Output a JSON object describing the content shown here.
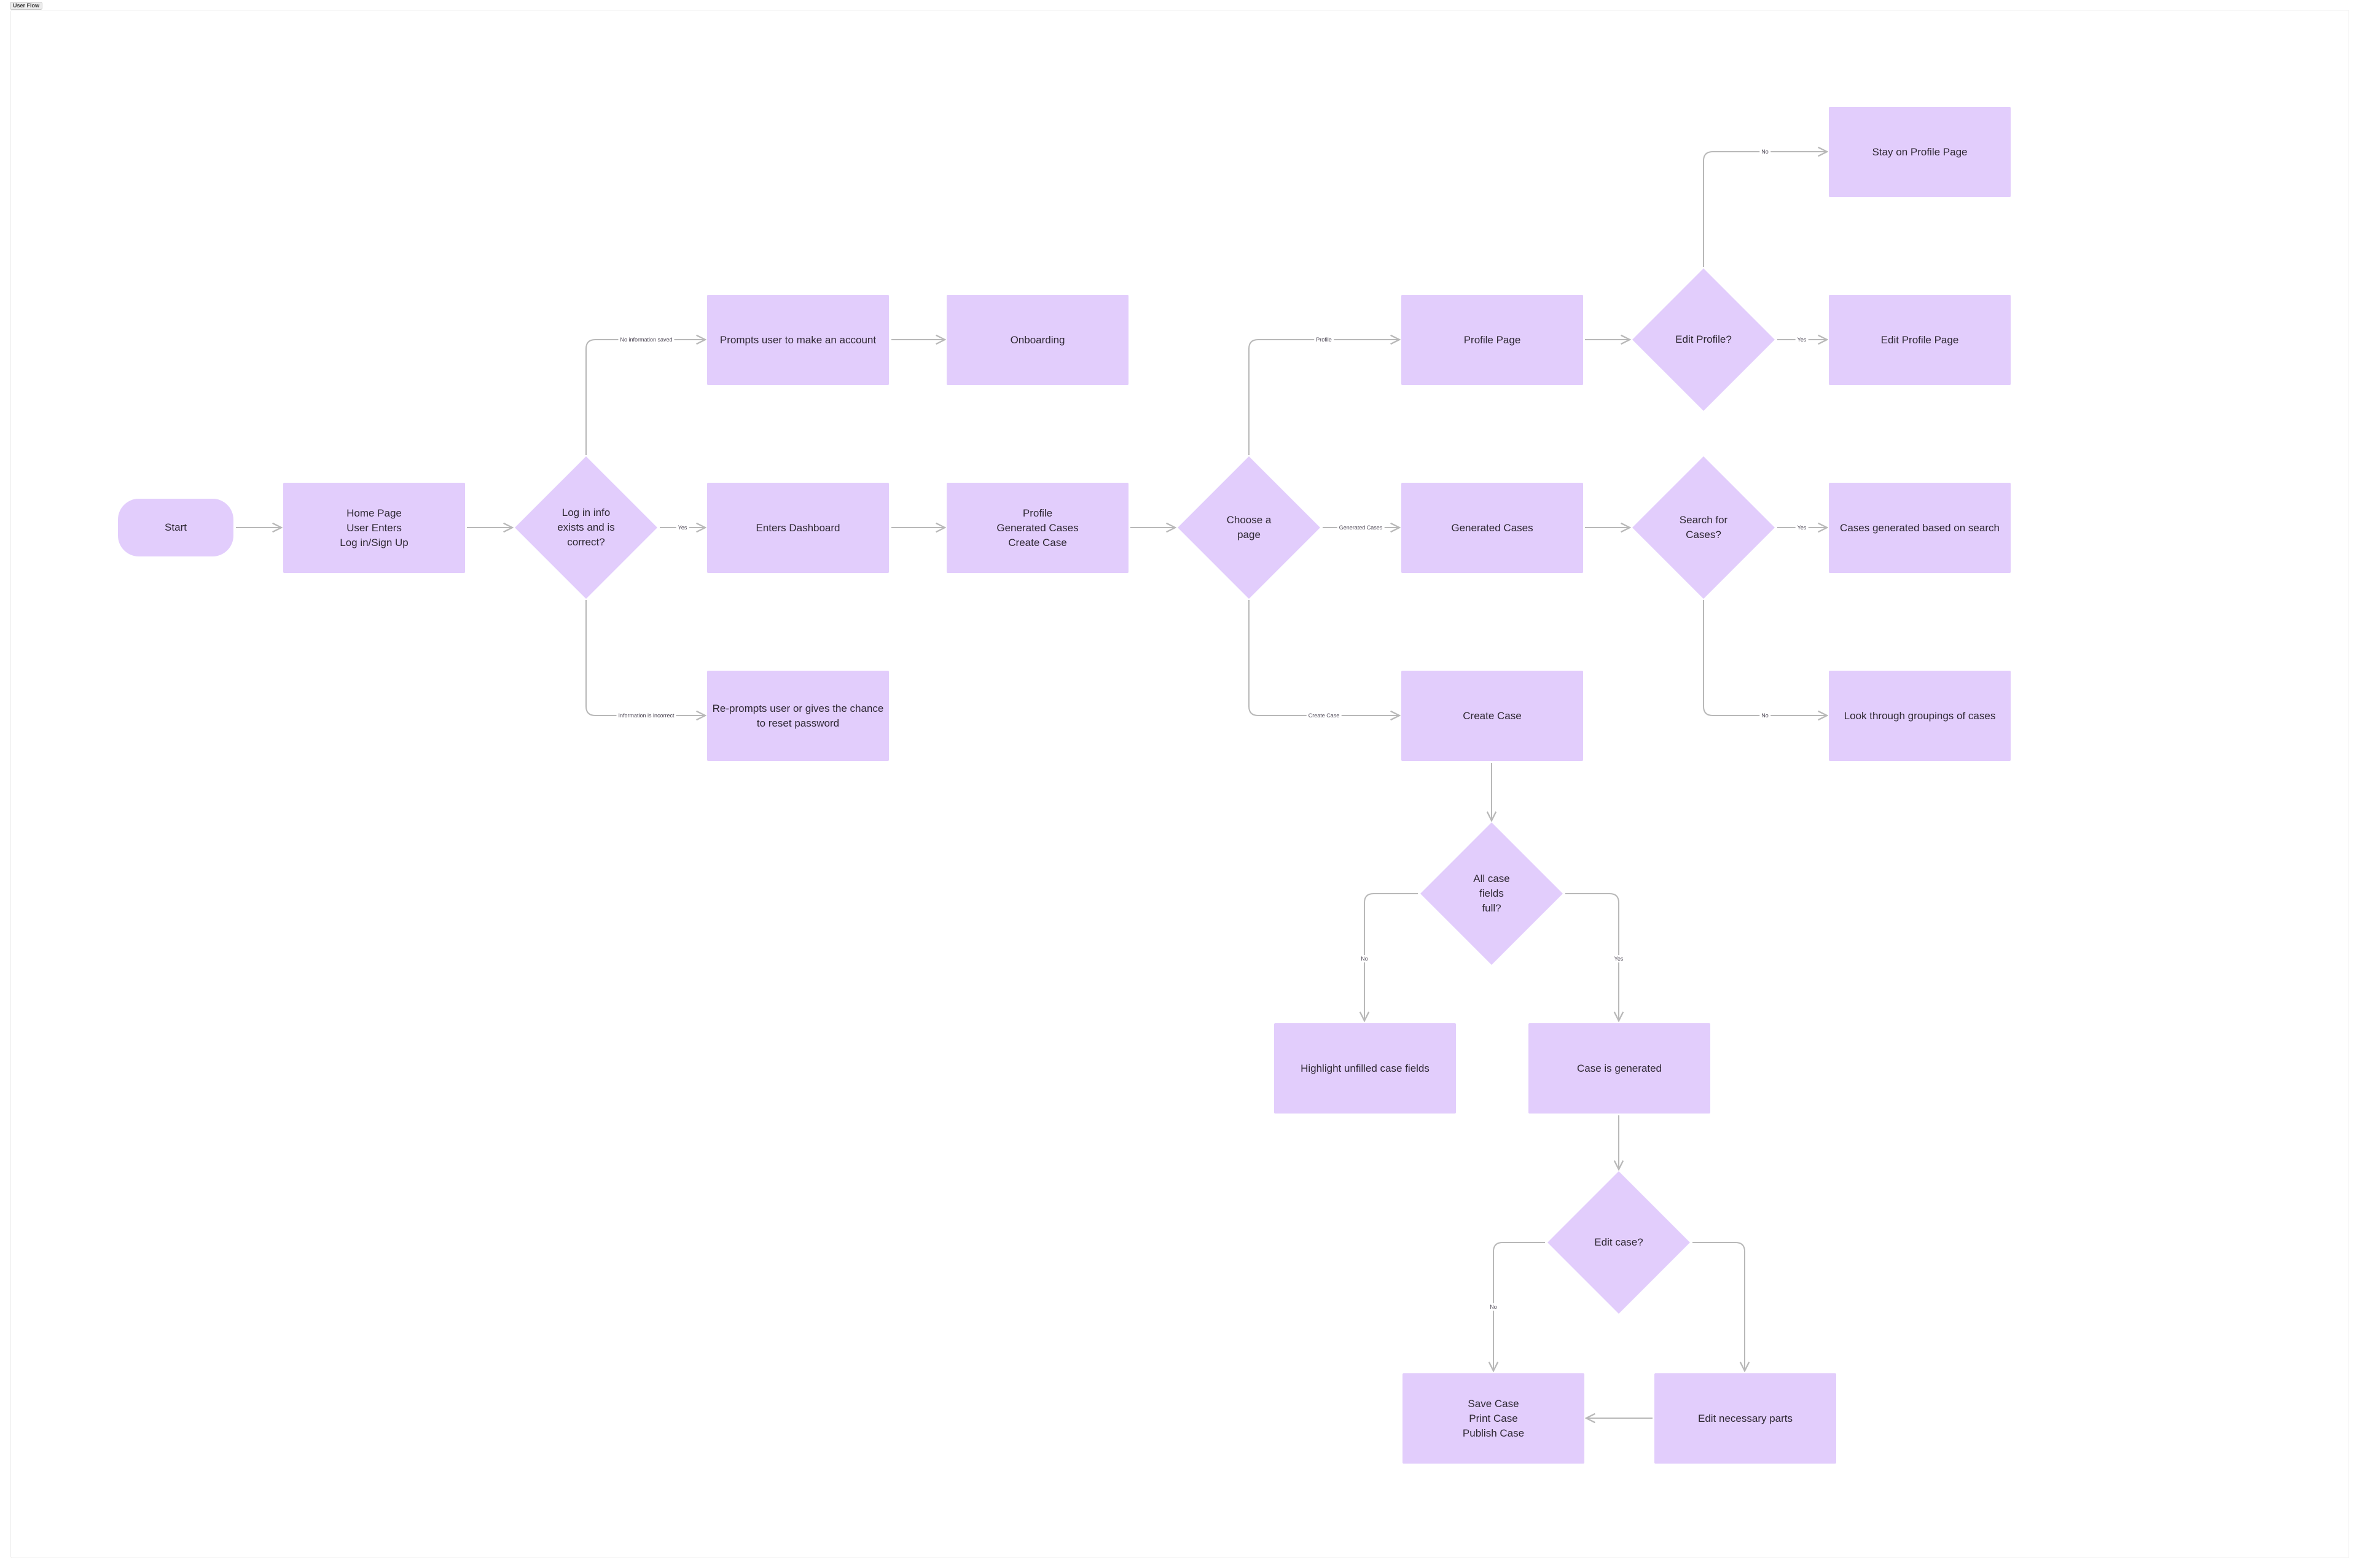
{
  "frame": {
    "title": "User Flow"
  },
  "colors": {
    "node_fill": "#e2cdfc",
    "edge": "#b8b8b8",
    "text": "#2e2833"
  },
  "nodes": {
    "start": "Start",
    "home": "Home Page\nUser Enters\nLog in/Sign Up",
    "login_check": "Log in info\nexists and is\ncorrect?",
    "prompt_account": "Prompts user to make an account",
    "onboarding": "Onboarding",
    "enters_dashboard": "Enters Dashboard",
    "dashboard_menu": "Profile\nGenerated Cases\nCreate Case",
    "reprompt": "Re-prompts user or gives the chance\nto reset password",
    "choose_page": "Choose a page",
    "profile_page": "Profile Page",
    "generated_cases": "Generated Cases",
    "create_case": "Create Case",
    "edit_profile_q": "Edit Profile?",
    "stay_profile": "Stay on Profile Page",
    "edit_profile_page": "Edit Profile Page",
    "search_cases_q": "Search for\nCases?",
    "cases_by_search": "Cases generated based on search",
    "look_groupings": "Look through groupings of cases",
    "fields_full_q": "All case fields\nfull?",
    "highlight_fields": "Highlight unfilled case fields",
    "case_generated": "Case is generated",
    "edit_case_q": "Edit case?",
    "save_print_publish": "Save Case\nPrint Case\nPublish Case",
    "edit_parts": "Edit necessary parts"
  },
  "edge_labels": {
    "no_info_saved": "No information saved",
    "login_yes": "Yes",
    "info_incorrect": "Information is incorrect",
    "choose_profile": "Profile",
    "choose_generated": "Generated Cases",
    "choose_create": "Create Case",
    "edit_profile_no": "No",
    "edit_profile_yes": "Yes",
    "search_yes": "Yes",
    "search_no": "No",
    "fields_no": "No",
    "fields_yes": "Yes",
    "edit_case_no": "No"
  }
}
